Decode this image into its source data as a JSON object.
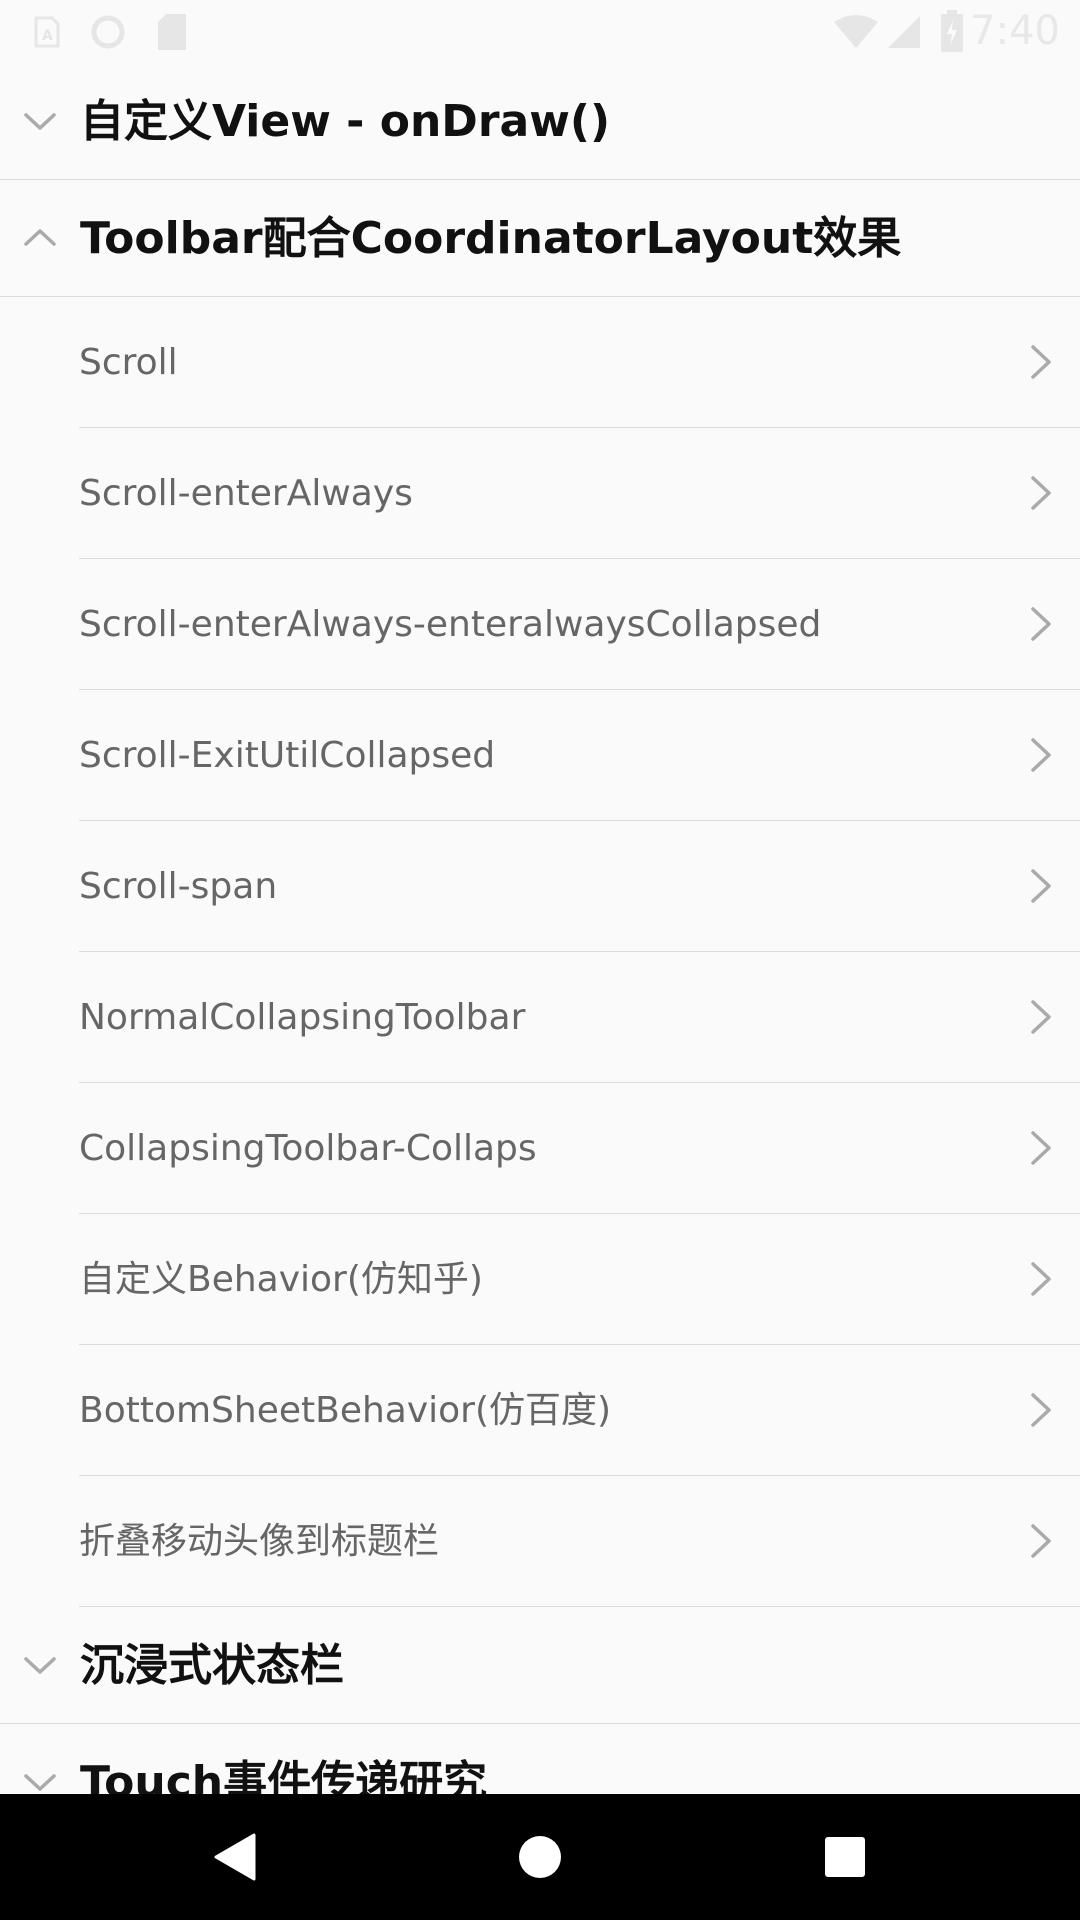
{
  "status_bar": {
    "time": "7:40",
    "icons": [
      "sim-icon",
      "sync-icon",
      "sd-card-icon",
      "wifi-icon",
      "signal-icon",
      "battery-icon"
    ]
  },
  "groups": [
    {
      "title": "自定义View - onDraw()",
      "expanded": false,
      "icon": "chevron-down-icon"
    },
    {
      "title": "Toolbar配合CoordinatorLayout效果",
      "expanded": true,
      "icon": "chevron-up-icon"
    },
    {
      "title": "沉浸式状态栏",
      "expanded": false,
      "icon": "chevron-down-icon"
    },
    {
      "title": "Touch事件传递研究",
      "expanded": false,
      "icon": "chevron-down-icon"
    }
  ],
  "children": [
    {
      "label": "Scroll"
    },
    {
      "label": "Scroll-enterAlways"
    },
    {
      "label": "Scroll-enterAlways-enteralwaysCollapsed"
    },
    {
      "label": "Scroll-ExitUtilCollapsed"
    },
    {
      "label": "Scroll-span"
    },
    {
      "label": "NormalCollapsingToolbar"
    },
    {
      "label": "CollapsingToolbar-Collaps"
    },
    {
      "label": "自定义Behavior(仿知乎)"
    },
    {
      "label": "BottomSheetBehavior(仿百度)"
    },
    {
      "label": "折叠移动头像到标题栏"
    }
  ],
  "nav_bar": {
    "buttons": [
      "back-button",
      "home-button",
      "recents-button"
    ]
  },
  "colors": {
    "background": "#fafafa",
    "divider": "#dcdcdc",
    "group_text": "#111111",
    "child_text": "#666666",
    "chevron": "#aaaaaa",
    "nav_bar": "#000000"
  }
}
